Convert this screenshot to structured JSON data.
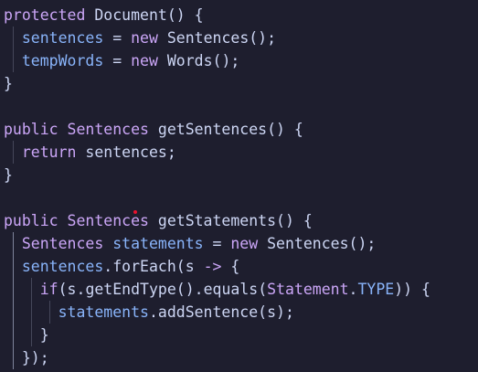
{
  "theme": {
    "background": "#1e1e2e",
    "keyword": "#cba6f7",
    "type": "#cba6f7",
    "function": "#cdd6f4",
    "variable": "#89b4fa",
    "plain": "#cdd6f4",
    "guide": "#45475a",
    "guide_active": "#7f849c",
    "error_marker": "#e8112d"
  },
  "lines": [
    [
      [
        "kw",
        "protected"
      ],
      [
        "p",
        " "
      ],
      [
        "fn",
        "Document"
      ],
      [
        "p",
        "() {"
      ]
    ],
    [
      [
        "p",
        "  "
      ],
      [
        "v",
        "sentences"
      ],
      [
        "p",
        " = "
      ],
      [
        "kw",
        "new"
      ],
      [
        "p",
        " "
      ],
      [
        "fn",
        "Sentences"
      ],
      [
        "p",
        "();"
      ]
    ],
    [
      [
        "p",
        "  "
      ],
      [
        "v",
        "tempWords"
      ],
      [
        "p",
        " = "
      ],
      [
        "kw",
        "new"
      ],
      [
        "p",
        " "
      ],
      [
        "fn",
        "Words"
      ],
      [
        "p",
        "();"
      ]
    ],
    [
      [
        "p",
        "}"
      ]
    ],
    [],
    [
      [
        "kw",
        "public"
      ],
      [
        "p",
        " "
      ],
      [
        "t",
        "Sentences"
      ],
      [
        "p",
        " "
      ],
      [
        "fn",
        "getSentences"
      ],
      [
        "p",
        "() {"
      ]
    ],
    [
      [
        "p",
        "  "
      ],
      [
        "kw",
        "return"
      ],
      [
        "p",
        " sentences;"
      ]
    ],
    [
      [
        "p",
        "}"
      ]
    ],
    [],
    [
      [
        "kw",
        "public"
      ],
      [
        "p",
        " "
      ],
      [
        "t",
        "Sentences"
      ],
      [
        "p",
        " "
      ],
      [
        "fn",
        "getStatements"
      ],
      [
        "p",
        "() {"
      ]
    ],
    [
      [
        "p",
        "  "
      ],
      [
        "t",
        "Sentences"
      ],
      [
        "p",
        " "
      ],
      [
        "v",
        "statements"
      ],
      [
        "p",
        " = "
      ],
      [
        "kw",
        "new"
      ],
      [
        "p",
        " "
      ],
      [
        "fn",
        "Sentences"
      ],
      [
        "p",
        "();"
      ]
    ],
    [
      [
        "p",
        "  "
      ],
      [
        "v",
        "sentences"
      ],
      [
        "p",
        "."
      ],
      [
        "fn",
        "forEach"
      ],
      [
        "p",
        "(s "
      ],
      [
        "kw",
        "->"
      ],
      [
        "p",
        " {"
      ]
    ],
    [
      [
        "p",
        "    "
      ],
      [
        "kw",
        "if"
      ],
      [
        "p",
        "(s."
      ],
      [
        "fn",
        "getEndType"
      ],
      [
        "p",
        "()."
      ],
      [
        "fn",
        "equals"
      ],
      [
        "p",
        "("
      ],
      [
        "t",
        "Statement"
      ],
      [
        "p",
        "."
      ],
      [
        "v",
        "TYPE"
      ],
      [
        "p",
        ")) {"
      ]
    ],
    [
      [
        "p",
        "      "
      ],
      [
        "v",
        "statements"
      ],
      [
        "p",
        "."
      ],
      [
        "fn",
        "addSentence"
      ],
      [
        "p",
        "(s);"
      ]
    ],
    [
      [
        "p",
        "    }"
      ]
    ],
    [
      [
        "p",
        "  });"
      ]
    ]
  ]
}
